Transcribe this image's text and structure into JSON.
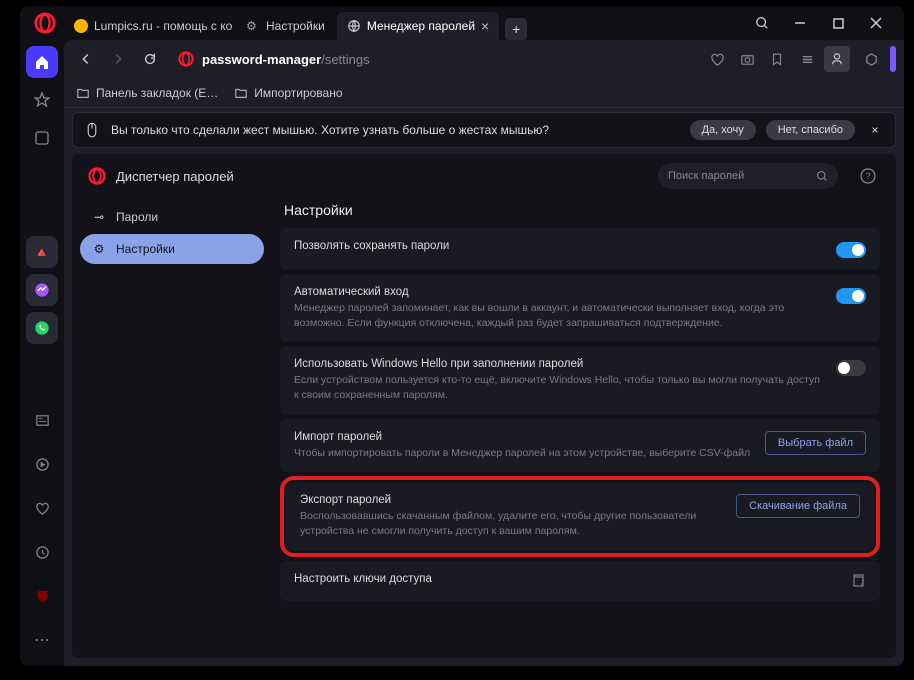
{
  "tabs": [
    {
      "label": "Lumpics.ru - помощь с ко"
    },
    {
      "label": "Настройки"
    },
    {
      "label": "Менеджер паролей"
    }
  ],
  "addressbar": {
    "url_prefix": "password-manager",
    "url_suffix": "/settings"
  },
  "bookmarks": [
    {
      "label": "Панель закладок (E…"
    },
    {
      "label": "Импортировано"
    }
  ],
  "banner": {
    "text": "Вы только что сделали жест мышью. Хотите узнать больше о жестах мышью?",
    "yes": "Да, хочу",
    "no": "Нет, спасибо"
  },
  "page": {
    "title": "Диспетчер паролей",
    "search_placeholder": "Поиск паролей"
  },
  "sidenav": {
    "passwords": "Пароли",
    "settings": "Настройки"
  },
  "settings": {
    "heading": "Настройки",
    "row1": {
      "label": "Позволять сохранять пароли"
    },
    "row2": {
      "label": "Автоматический вход",
      "desc": "Менеджер паролей запоминает, как вы вошли в аккаунт, и автоматически выполняет вход, когда это возможно. Если функция отключена, каждый раз будет запрашиваться подтверждение."
    },
    "row3": {
      "label": "Использовать Windows Hello при заполнении паролей",
      "desc": "Если устройством пользуется кто-то ещё, включите Windows Hello, чтобы только вы могли получать доступ к своим сохраненным паролям."
    },
    "row4": {
      "label": "Импорт паролей",
      "desc": "Чтобы импортировать пароли в Менеджер паролей на этом устройстве, выберите CSV-файл",
      "button": "Выбрать файл"
    },
    "row5": {
      "label": "Экспорт паролей",
      "desc": "Воспользовавшись скачанным файлом, удалите его, чтобы другие пользователи устройства не смогли получить доступ к вашим паролям.",
      "button": "Скачивание файла"
    },
    "row6": {
      "label": "Настроить ключи доступа"
    }
  }
}
